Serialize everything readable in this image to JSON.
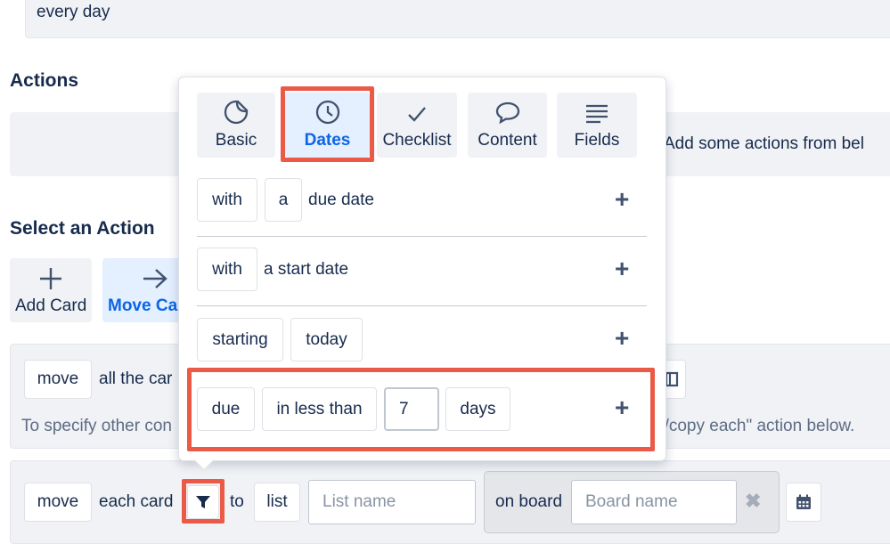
{
  "trigger": {
    "text": "every day"
  },
  "actions": {
    "heading": "Actions",
    "placeholder": "Add some actions from bel"
  },
  "select_action": {
    "heading": "Select an Action",
    "add_card_label": "Add Card",
    "move_card_label": "Move Ca"
  },
  "row1": {
    "move_label": "move",
    "text": "all the car",
    "hint_left": "To specify other con",
    "hint_right": "e/copy each\" action below."
  },
  "row2": {
    "move_label": "move",
    "each_card": "each card",
    "to": "to",
    "list": "list",
    "list_placeholder": "List name",
    "on_board": "on board",
    "board_placeholder": "Board name"
  },
  "popover": {
    "tabs": [
      {
        "label": "Basic",
        "icon": "sticker-icon"
      },
      {
        "label": "Dates",
        "icon": "clock-icon"
      },
      {
        "label": "Checklist",
        "icon": "check-icon"
      },
      {
        "label": "Content",
        "icon": "speech-bubble-icon"
      },
      {
        "label": "Fields",
        "icon": "lines-icon"
      }
    ],
    "active_tab": "Dates",
    "rows": [
      {
        "chips": [
          "with",
          "a"
        ],
        "text": "due date"
      },
      {
        "chips": [
          "with"
        ],
        "text": "a start date"
      },
      {
        "chips": [
          "starting",
          "today"
        ],
        "text": ""
      },
      {
        "chips": [
          "due",
          "in less than"
        ],
        "input_value": "7",
        "chips_after": [
          "days"
        ]
      }
    ]
  },
  "colors": {
    "accent_blue": "#0c66e4",
    "highlight_red": "#ea5a47",
    "panel_gray": "#f0f2f5",
    "active_tab_bg": "#e4efff"
  }
}
